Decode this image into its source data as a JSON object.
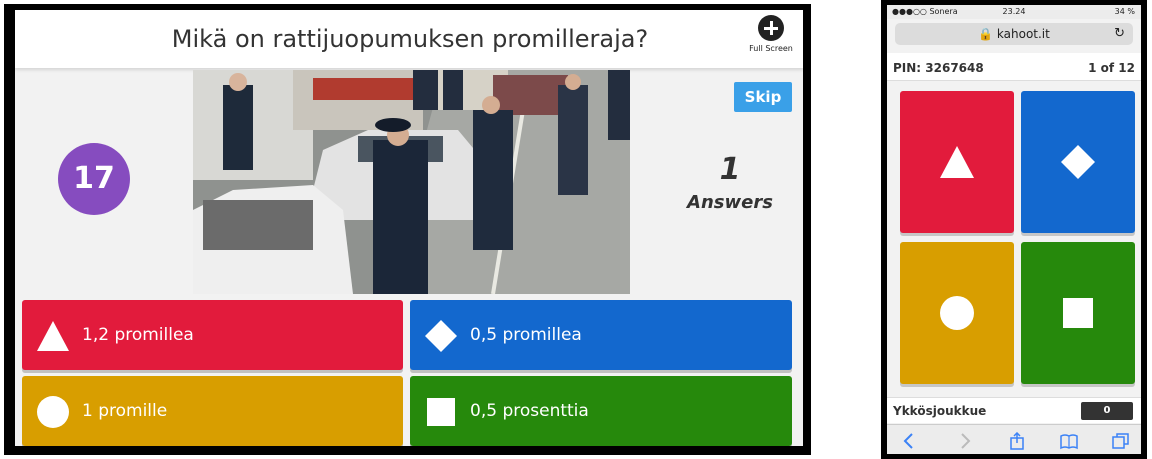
{
  "presenter": {
    "question": "Mikä on rattijuopumuksen promilleraja?",
    "fullscreen_label": "Full Screen",
    "timer": "17",
    "skip_label": "Skip",
    "answers_count": "1",
    "answers_label": "Answers",
    "answers": [
      {
        "shape": "triangle-icon",
        "text": "1,2 promillea",
        "color": "#e21b3c"
      },
      {
        "shape": "diamond-icon",
        "text": "0,5 promillea",
        "color": "#1368ce"
      },
      {
        "shape": "circle-icon",
        "text": "1 promille",
        "color": "#d89e00"
      },
      {
        "shape": "square-icon",
        "text": "0,5 prosenttia",
        "color": "#26890c"
      }
    ]
  },
  "phone": {
    "carrier": "●●●○○ Sonera",
    "time": "23.24",
    "battery": "34 %",
    "url": "kahoot.it",
    "pin": "PIN: 3267648",
    "progress": "1 of 12",
    "player_name": "Ykkösjoukkue",
    "score": "0"
  }
}
